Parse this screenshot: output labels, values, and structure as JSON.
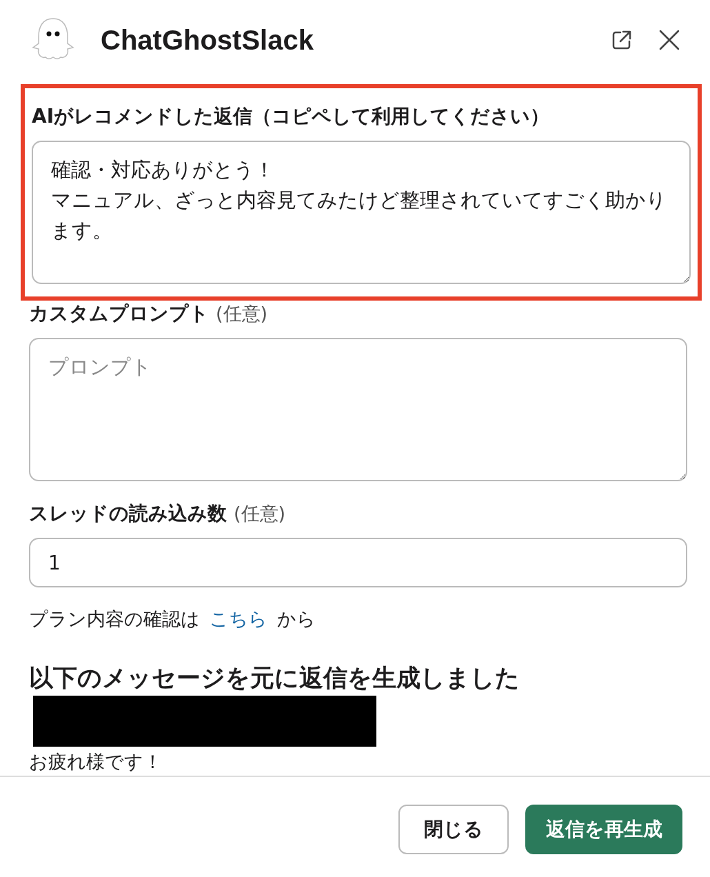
{
  "header": {
    "title": "ChatGhostSlack"
  },
  "recommended": {
    "label": "AIがレコメンドした返信（コピペして利用してください）",
    "lines": [
      "確認・対応ありがとう！",
      "マニュアル、ざっと内容見てみたけど整理されていてすごく助かります。"
    ],
    "highlighted": true
  },
  "custom_prompt": {
    "label": "カスタムプロンプト",
    "optional": "(任意)",
    "placeholder": "プロンプト"
  },
  "thread_count": {
    "label": "スレッドの読み込み数",
    "optional": "(任意)",
    "value": "1"
  },
  "plan_note": {
    "before": "プラン内容の確認は",
    "link": "こちら",
    "after": "から"
  },
  "source": {
    "heading": "以下のメッセージを元に返信を生成しました",
    "message": "お疲れ様です！"
  },
  "buttons": [
    {
      "label": "閉じる",
      "kind": "secondary"
    },
    {
      "label": "返信を再生成",
      "kind": "primary"
    }
  ]
}
